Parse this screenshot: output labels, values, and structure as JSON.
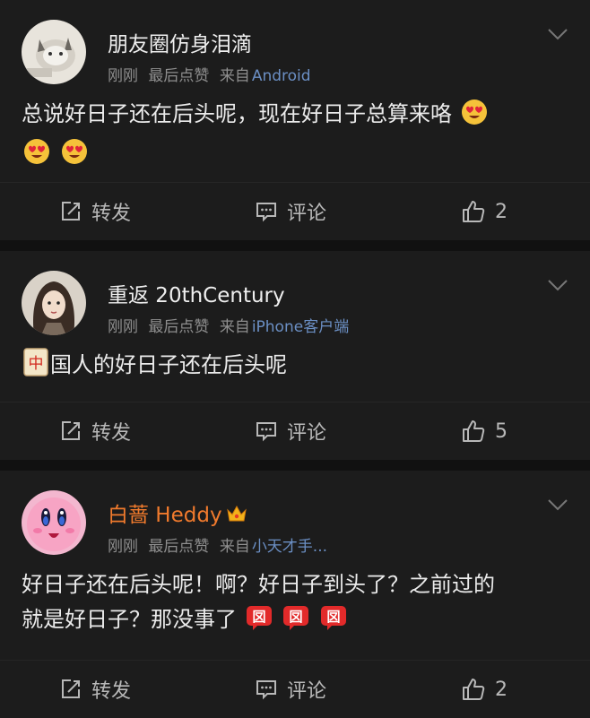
{
  "posts": [
    {
      "username": "朋友圈仿身泪滴",
      "time": "刚刚",
      "last_like": "最后点赞",
      "source_prefix": "来自",
      "source": "Android",
      "text": "总说好日子还在后头呢，现在好日子总算来咯",
      "emoji_icon": "heart-eyes-emoji",
      "repost_label": "转发",
      "comment_label": "评论",
      "like_count": "2"
    },
    {
      "username": "重返 20thCentury",
      "time": "刚刚",
      "last_like": "最后点赞",
      "source_prefix": "来自",
      "source": "iPhone客户端",
      "text_icon": "mahjong-red-dragon-icon",
      "text": "国人的好日子还在后头呢",
      "repost_label": "转发",
      "comment_label": "评论",
      "like_count": "5"
    },
    {
      "username": "白蔷 Heddy",
      "username_color": "#f07a2d",
      "badge_icon": "crown-icon",
      "time": "刚刚",
      "last_like": "最后点赞",
      "source_prefix": "来自",
      "source": "小天才手...",
      "text_line1": "好日子还在后头呢！啊？好日子到头了？之前过的",
      "text_line2": "就是好日子？那没事了",
      "emoji_icon": "jiong-red-emoji",
      "repost_label": "转发",
      "comment_label": "评论",
      "like_count": "2"
    }
  ],
  "colors": {
    "background": "#111111",
    "card": "#1c1c1c",
    "source_link": "#6b8fc4",
    "vip_name": "#f07a2d"
  }
}
